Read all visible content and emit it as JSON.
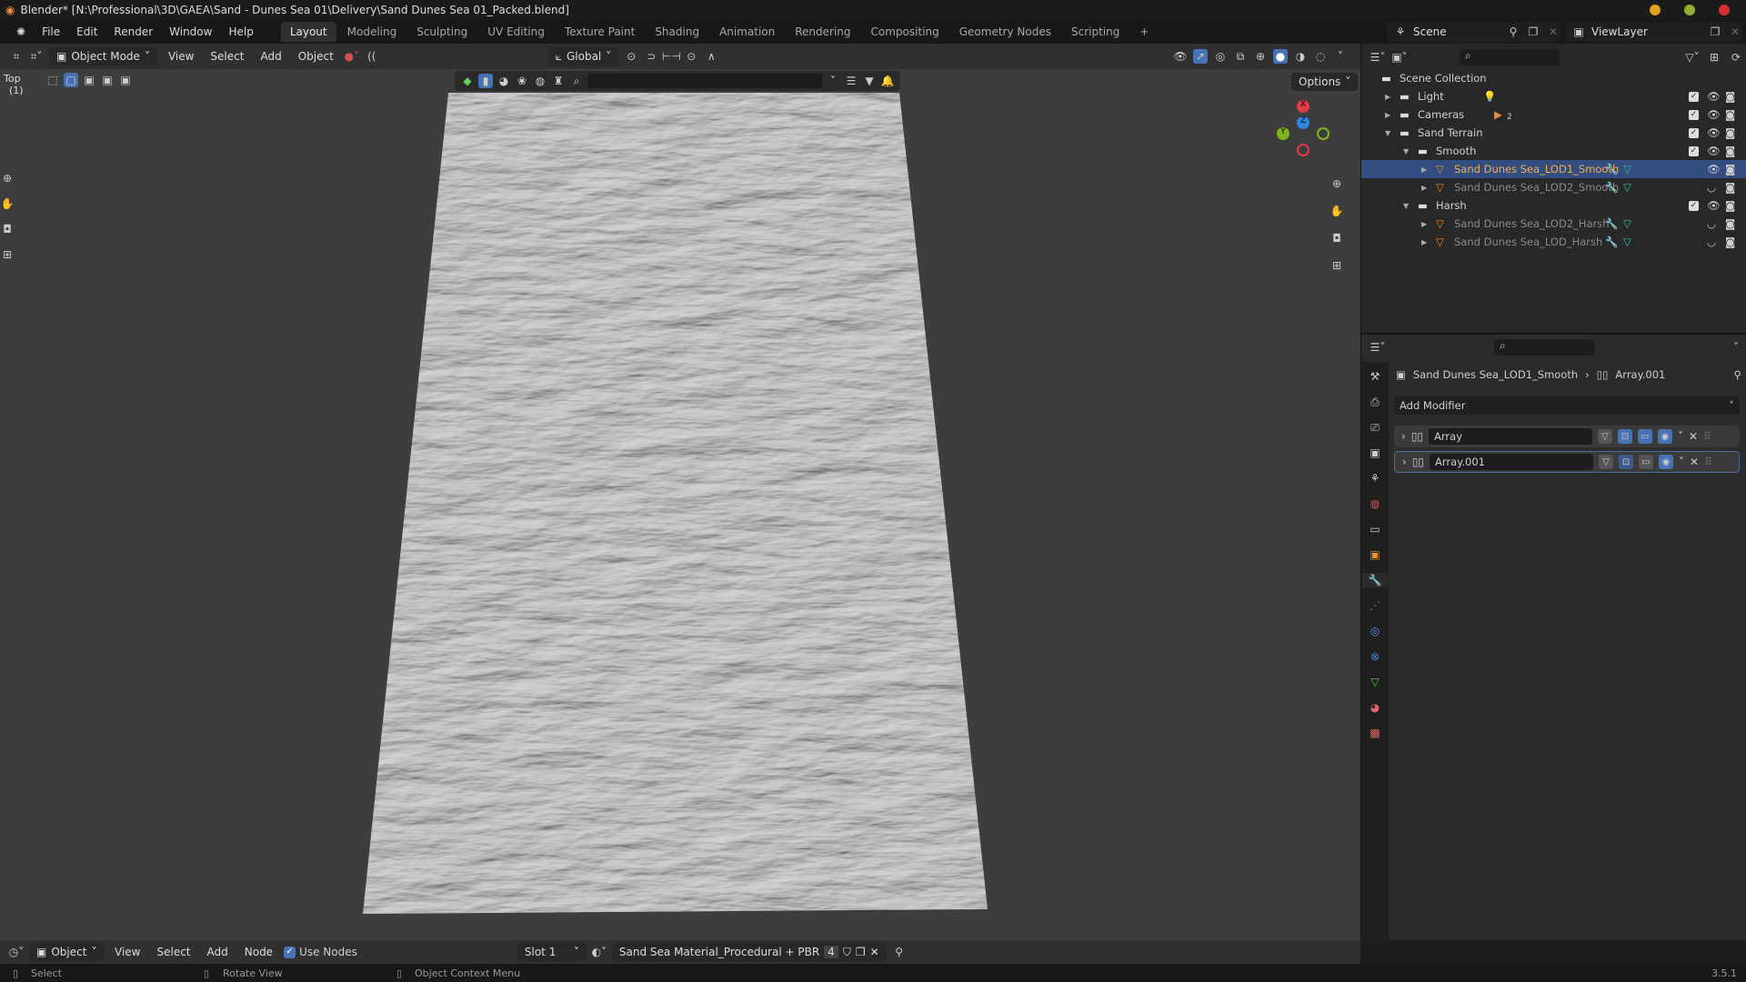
{
  "window": {
    "title": "Blender* [N:\\Professional\\3D\\GAEA\\Sand - Dunes Sea 01\\Delivery\\Sand Dunes Sea 01_Packed.blend]"
  },
  "menu": [
    "File",
    "Edit",
    "Render",
    "Window",
    "Help"
  ],
  "workspaces": [
    "Layout",
    "Modeling",
    "Sculpting",
    "UV Editing",
    "Texture Paint",
    "Shading",
    "Animation",
    "Rendering",
    "Compositing",
    "Geometry Nodes",
    "Scripting",
    "+"
  ],
  "header": {
    "mode": "Object Mode",
    "items": [
      "View",
      "Select",
      "Add",
      "Object"
    ],
    "orientation": "Global",
    "options": "Options"
  },
  "viewport": {
    "view_name": "Top",
    "collection": "(1)",
    "shading": "solid"
  },
  "topbar": {
    "scene": "Scene",
    "view_layer": "ViewLayer"
  },
  "outliner": {
    "rows": [
      {
        "label": "Scene Collection",
        "depth": 0,
        "type": "collection"
      },
      {
        "label": "Light",
        "depth": 1,
        "type": "collection",
        "extra": "light",
        "check": true
      },
      {
        "label": "Cameras",
        "depth": 1,
        "type": "collection",
        "extra": "camera",
        "count": "2",
        "check": true
      },
      {
        "label": "Sand Terrain",
        "depth": 1,
        "type": "collection",
        "check": true,
        "open": true
      },
      {
        "label": "Smooth",
        "depth": 2,
        "type": "collection",
        "check": true,
        "open": true
      },
      {
        "label": "Sand Dunes Sea_LOD1_Smooth",
        "depth": 3,
        "type": "mesh",
        "selected": true
      },
      {
        "label": "Sand Dunes Sea_LOD2_Smooth",
        "depth": 3,
        "type": "mesh",
        "hidden": true
      },
      {
        "label": "Harsh",
        "depth": 2,
        "type": "collection",
        "check": true,
        "open": true
      },
      {
        "label": "Sand Dunes Sea_LOD2_Harsh",
        "depth": 3,
        "type": "mesh",
        "hidden": true
      },
      {
        "label": "Sand Dunes Sea_LOD_Harsh",
        "depth": 3,
        "type": "mesh",
        "hidden": true
      }
    ]
  },
  "properties": {
    "object": "Sand Dunes Sea_LOD1_Smooth",
    "modifier": "Array.001",
    "add_modifier": "Add Modifier",
    "modifiers": [
      "Array",
      "Array.001"
    ]
  },
  "shader": {
    "editor": "Object",
    "items": [
      "View",
      "Select",
      "Add",
      "Node"
    ],
    "use_nodes": "Use Nodes",
    "slot": "Slot 1",
    "material": "Sand Sea Material_Procedural + PBR",
    "users": "4"
  },
  "status": {
    "left": "Select",
    "middle": "Rotate View",
    "right": "Object Context Menu",
    "version": "3.5.1"
  },
  "colors": {
    "accent": "#4772b3",
    "selection": "#334d80",
    "object_orange": "#f0a050",
    "axis_x": "#e33a4a",
    "axis_y": "#7fb51a",
    "axis_z": "#2e86e0"
  }
}
